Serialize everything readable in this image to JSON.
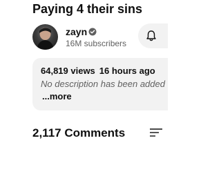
{
  "video": {
    "title": "Paying 4 their sins"
  },
  "channel": {
    "name": "zayn",
    "subscribers": "16M subscribers",
    "verified_icon": "verified-check-icon",
    "avatar": "channel-avatar"
  },
  "notifications": {
    "icon": "bell-icon"
  },
  "description": {
    "views": "64,819 views",
    "posted": "16 hours ago",
    "text": "No description has been added t",
    "more_label": "...more"
  },
  "comments": {
    "count_label": "2,117 Comments",
    "sort_icon": "sort-icon"
  },
  "colors": {
    "text_primary": "#0f0f0f",
    "text_secondary": "#606060",
    "surface": "#f2f2f2",
    "background": "#ffffff"
  }
}
